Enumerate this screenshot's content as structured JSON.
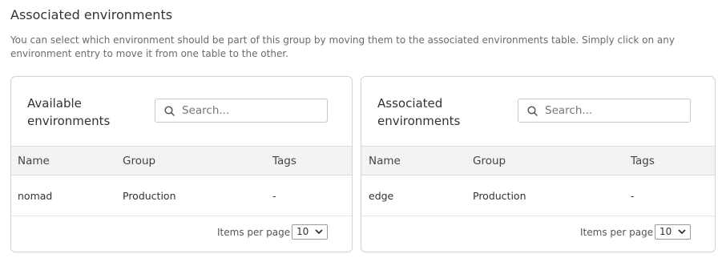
{
  "section": {
    "title": "Associated environments",
    "description": "You can select which environment should be part of this group by moving them to the associated environments table. Simply click on any environment entry to move it from one table to the other."
  },
  "available": {
    "title": "Available environments",
    "search_placeholder": "Search...",
    "columns": [
      "Name",
      "Group",
      "Tags"
    ],
    "rows": [
      {
        "name": "nomad",
        "group": "Production",
        "tags": "-"
      }
    ],
    "items_per_page_label": "Items per page",
    "items_per_page_value": "10"
  },
  "associated": {
    "title": "Associated environments",
    "search_placeholder": "Search...",
    "columns": [
      "Name",
      "Group",
      "Tags"
    ],
    "rows": [
      {
        "name": "edge",
        "group": "Production",
        "tags": "-"
      }
    ],
    "items_per_page_label": "Items per page",
    "items_per_page_value": "10"
  },
  "icons": {
    "search": "search-icon",
    "select_caret": "chevron-down-icon"
  }
}
